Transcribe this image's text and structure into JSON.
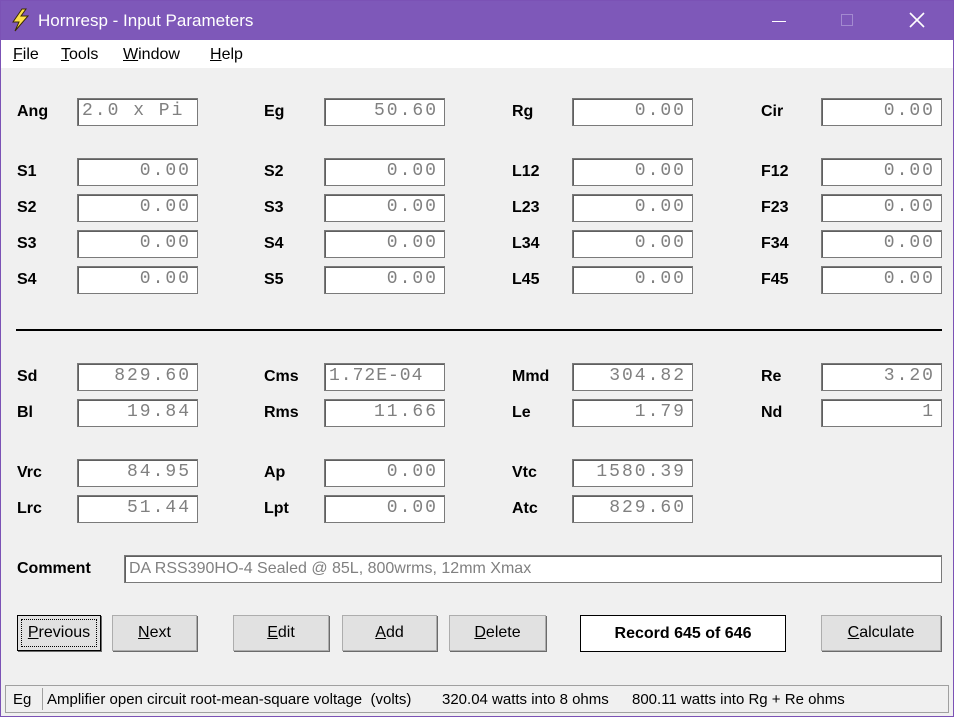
{
  "window": {
    "title": "Hornresp - Input Parameters",
    "accent_color": "#7e58b9",
    "icon": "lightning-icon"
  },
  "menu": [
    {
      "label": "File",
      "hotkey": "F",
      "rest": "ile"
    },
    {
      "label": "Tools",
      "hotkey": "T",
      "rest": "ools"
    },
    {
      "label": "Window",
      "hotkey": "W",
      "rest": "indow"
    },
    {
      "label": "Help",
      "hotkey": "H",
      "rest": "elp"
    }
  ],
  "source": {
    "ang": {
      "label": "Ang",
      "value": "2.0 x Pi"
    },
    "eg": {
      "label": "Eg",
      "value": "50.60"
    },
    "rg": {
      "label": "Rg",
      "value": "0.00"
    },
    "cir": {
      "label": "Cir",
      "value": "0.00"
    }
  },
  "horn": {
    "col1": [
      {
        "label": "S1",
        "value": "0.00"
      },
      {
        "label": "S2",
        "value": "0.00"
      },
      {
        "label": "S3",
        "value": "0.00"
      },
      {
        "label": "S4",
        "value": "0.00"
      }
    ],
    "col2": [
      {
        "label": "S2",
        "value": "0.00"
      },
      {
        "label": "S3",
        "value": "0.00"
      },
      {
        "label": "S4",
        "value": "0.00"
      },
      {
        "label": "S5",
        "value": "0.00"
      }
    ],
    "col3": [
      {
        "label": "L12",
        "value": "0.00"
      },
      {
        "label": "L23",
        "value": "0.00"
      },
      {
        "label": "L34",
        "value": "0.00"
      },
      {
        "label": "L45",
        "value": "0.00"
      }
    ],
    "col4": [
      {
        "label": "F12",
        "value": "0.00"
      },
      {
        "label": "F23",
        "value": "0.00"
      },
      {
        "label": "F34",
        "value": "0.00"
      },
      {
        "label": "F45",
        "value": "0.00"
      }
    ]
  },
  "driver": {
    "sd": {
      "label": "Sd",
      "value": "829.60"
    },
    "cms": {
      "label": "Cms",
      "value": "1.72E-04"
    },
    "mmd": {
      "label": "Mmd",
      "value": "304.82"
    },
    "re": {
      "label": "Re",
      "value": "3.20"
    },
    "bl": {
      "label": "Bl",
      "value": "19.84"
    },
    "rms": {
      "label": "Rms",
      "value": "11.66"
    },
    "le": {
      "label": "Le",
      "value": "1.79"
    },
    "nd": {
      "label": "Nd",
      "value": "1"
    }
  },
  "chambers": {
    "vrc": {
      "label": "Vrc",
      "value": "84.95"
    },
    "ap": {
      "label": "Ap",
      "value": "0.00"
    },
    "vtc": {
      "label": "Vtc",
      "value": "1580.39"
    },
    "lrc": {
      "label": "Lrc",
      "value": "51.44"
    },
    "lpt": {
      "label": "Lpt",
      "value": "0.00"
    },
    "atc": {
      "label": "Atc",
      "value": "829.60"
    }
  },
  "comment": {
    "label": "Comment",
    "value": "DA RSS390HO-4 Sealed @ 85L, 800wrms, 12mm Xmax"
  },
  "buttons": {
    "previous": {
      "hotkey": "P",
      "rest": "revious"
    },
    "next": {
      "hotkey": "N",
      "rest": "ext"
    },
    "edit": {
      "hotkey": "E",
      "rest": "dit"
    },
    "add": {
      "hotkey": "A",
      "rest": "dd"
    },
    "delete": {
      "hotkey": "D",
      "rest": "elete"
    },
    "calculate": {
      "hotkey": "C",
      "rest": "alculate"
    }
  },
  "record": "Record 645 of 646",
  "status": {
    "param": "Eg",
    "description": "Amplifier open circuit root-mean-square voltage  (volts)",
    "power_8": "320.04 watts into 8 ohms",
    "power_rg": "800.11 watts into Rg + Re ohms"
  }
}
